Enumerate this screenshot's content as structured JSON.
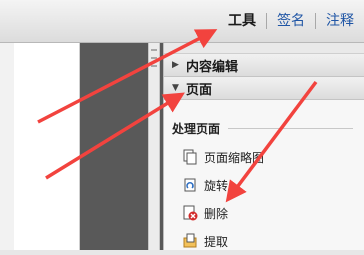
{
  "toolbar": {
    "tabs": [
      {
        "label": "工具"
      },
      {
        "label": "签名"
      },
      {
        "label": "注释"
      }
    ]
  },
  "panel": {
    "sections": [
      {
        "label": "内容编辑",
        "expanded": false
      },
      {
        "label": "页面",
        "expanded": true
      }
    ],
    "group_title": "处理页面",
    "items": [
      {
        "label": "页面缩略图",
        "icon": "page-thumbnails-icon"
      },
      {
        "label": "旋转",
        "icon": "rotate-icon"
      },
      {
        "label": "删除",
        "icon": "delete-icon"
      },
      {
        "label": "提取",
        "icon": "extract-icon"
      }
    ]
  },
  "annotation_color": "#f2433e"
}
